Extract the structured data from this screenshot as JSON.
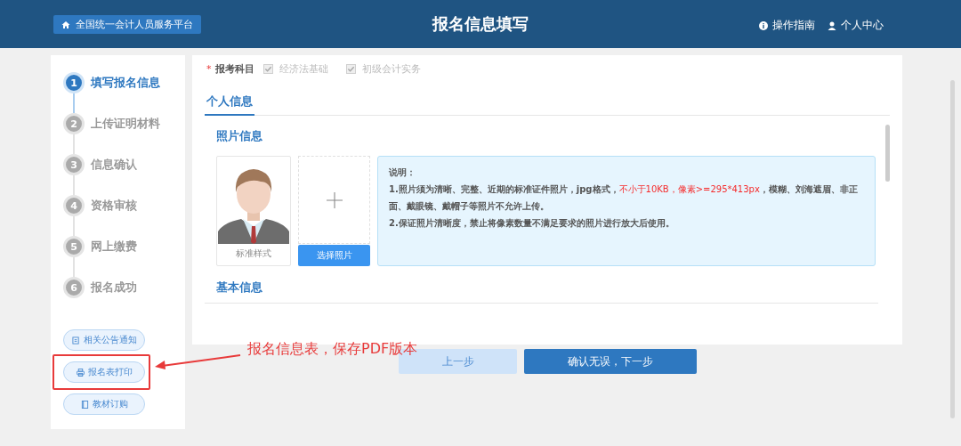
{
  "header": {
    "home_link": "全国统一会计人员服务平台",
    "title": "报名信息填写",
    "links": [
      {
        "kind": "info",
        "label": "操作指南"
      },
      {
        "kind": "user",
        "label": "个人中心"
      }
    ]
  },
  "steps": [
    {
      "number": "1",
      "label": "填写报名信息",
      "selected": true
    },
    {
      "number": "2",
      "label": "上传证明材料",
      "selected": false
    },
    {
      "number": "3",
      "label": "信息确认",
      "selected": false
    },
    {
      "number": "4",
      "label": "资格审核",
      "selected": false
    },
    {
      "number": "5",
      "label": "网上缴费",
      "selected": false
    },
    {
      "number": "6",
      "label": "报名成功",
      "selected": false
    }
  ],
  "side_links": [
    {
      "kind": "notice",
      "label": "相关公告通知"
    },
    {
      "kind": "print",
      "label": "报名表打印"
    },
    {
      "kind": "book",
      "label": "教材订购"
    }
  ],
  "form": {
    "required_mark": "*",
    "subject_label": "报考科目",
    "subjects": [
      {
        "label": "经济法基础",
        "checked": true,
        "disabled": true
      },
      {
        "label": "初级会计实务",
        "checked": true,
        "disabled": true
      }
    ],
    "tabs": [
      {
        "label": "个人信息",
        "selected": true
      }
    ],
    "photo_section": {
      "title": "照片信息",
      "sample_caption": "标准样式",
      "upload_button": "选择照片",
      "note_title": "说明：",
      "note_paragraphs": [
        [
          {
            "text": "1.照片须为清晰、完整、近期的标准证件照片，jpg格式，",
            "highlight": false
          },
          {
            "text": "不小于10KB，像素>=295*413px",
            "highlight": true
          },
          {
            "text": "，模糊、刘海遮眉、非正面、戴眼镜、戴帽子等照片不允许上传。",
            "highlight": false
          }
        ],
        [
          {
            "text": "2.保证照片清晰度，禁止将像素数量不满足要求的照片进行放大后使用。",
            "highlight": false
          }
        ]
      ]
    },
    "basic_section": {
      "title": "基本信息"
    }
  },
  "buttons": [
    {
      "kind": "secondary",
      "label": "上一步"
    },
    {
      "kind": "primary",
      "label": "确认无误，下一步"
    }
  ],
  "annotation": {
    "text": "报名信息表，保存PDF版本"
  }
}
